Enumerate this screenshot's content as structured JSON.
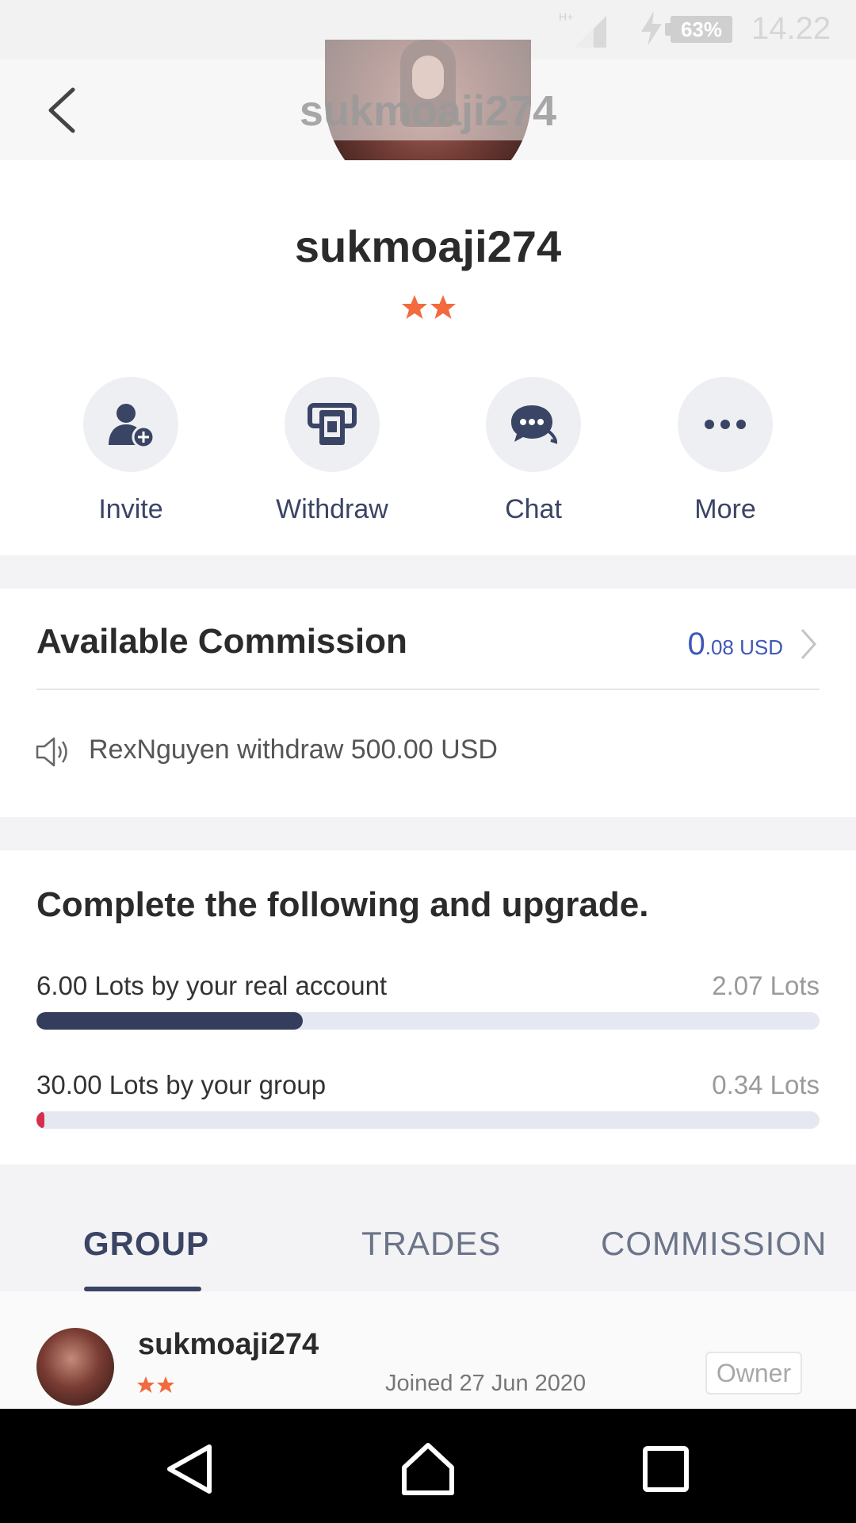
{
  "status_bar": {
    "network": "H+",
    "battery": "63%",
    "time": "14.22"
  },
  "header": {
    "title": "sukmoaji274"
  },
  "profile": {
    "name": "sukmoaji274",
    "stars": 2,
    "star_color": "#f26a3d"
  },
  "actions": [
    {
      "label": "Invite",
      "icon": "add-user-icon"
    },
    {
      "label": "Withdraw",
      "icon": "withdraw-icon"
    },
    {
      "label": "Chat",
      "icon": "chat-icon"
    },
    {
      "label": "More",
      "icon": "more-icon"
    }
  ],
  "commission": {
    "title": "Available Commission",
    "value_int": "0",
    "value_dec": ".08 USD",
    "notice": "RexNguyen withdraw 500.00 USD"
  },
  "upgrade": {
    "title": "Complete the following and upgrade.",
    "requirements": [
      {
        "label": "6.00 Lots by your real account",
        "value": "2.07 Lots",
        "progress": 0.34,
        "color": "#343d5c"
      },
      {
        "label": "30.00 Lots by your group",
        "value": "0.34 Lots",
        "progress": 0.01,
        "color": "#d4304a"
      }
    ]
  },
  "tabs": [
    {
      "label": "GROUP",
      "active": true
    },
    {
      "label": "TRADES",
      "active": false
    },
    {
      "label": "COMMISSION",
      "active": false
    }
  ],
  "members": [
    {
      "name": "sukmoaji274",
      "stars": 2,
      "joined": "Joined 27 Jun 2020",
      "role": "Owner"
    }
  ],
  "colors": {
    "accent": "#3a4464",
    "link": "#3f57b8",
    "background": "#f3f3f6"
  }
}
